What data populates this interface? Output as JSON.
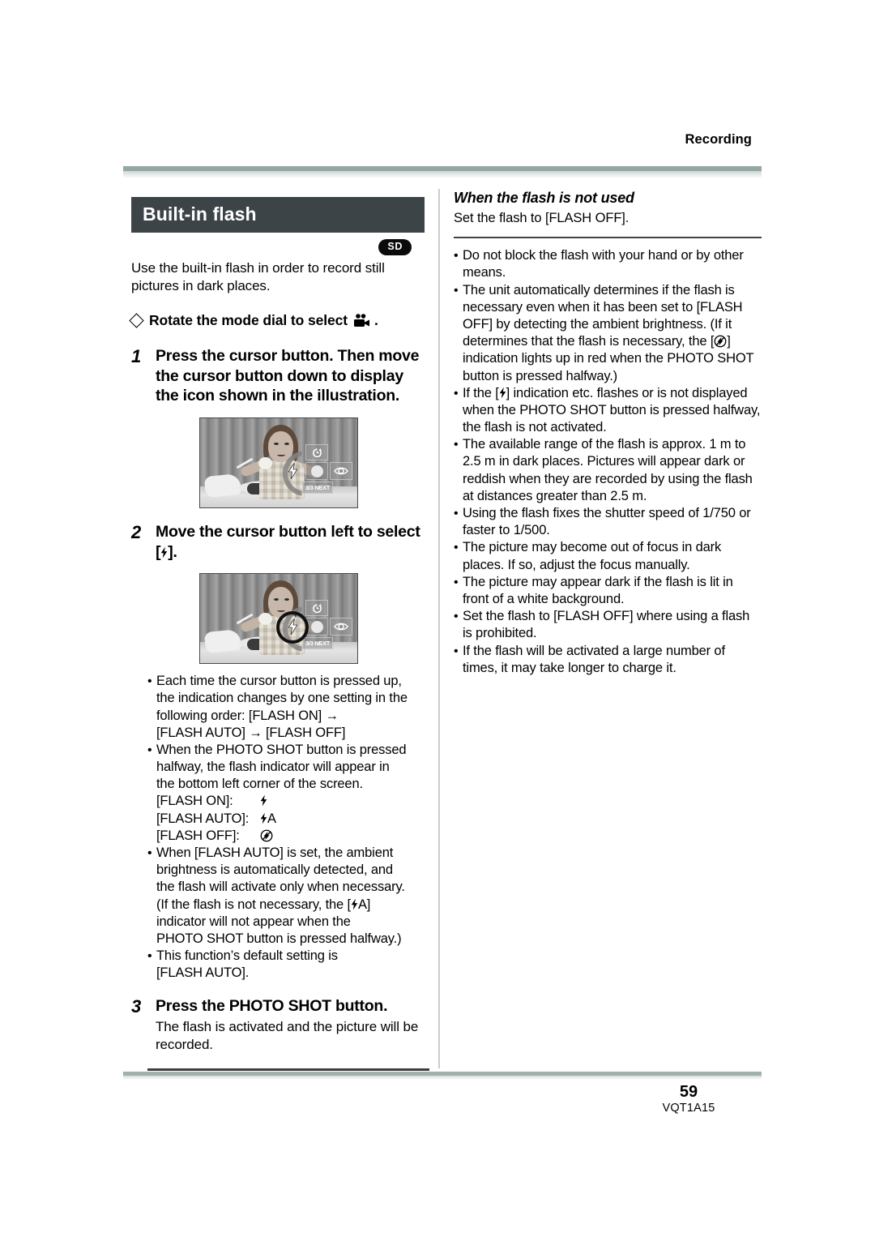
{
  "running_head": "Recording",
  "footer": {
    "page_number": "59",
    "doc_code": "VQT1A15"
  },
  "left_column": {
    "section_title": "Built-in flash",
    "sd_badge": "SD",
    "intro": "Use the built-in flash in order to record still pictures in dark places.",
    "prep_before": "Rotate the mode dial to select",
    "prep_after": ".",
    "steps": [
      {
        "number": "1",
        "text": "Press the cursor button. Then move the cursor button down to display the icon shown in the illustration."
      },
      {
        "number": "2",
        "text_before": "Move the cursor button left to select [",
        "text_after": "]."
      },
      {
        "number": "3",
        "text": "Press the PHOTO SHOT button.",
        "sub": "The flash is activated and the picture will be recorded."
      }
    ],
    "photo_osd": {
      "bottom_label": "3/3 NEXT",
      "top_icon": "self-timer-icon",
      "left_icon": "flash-icon",
      "right_icon": "red-eye-reduction-icon",
      "center_icon": "record-button-icon"
    },
    "bullets": [
      {
        "lines": [
          "Each time the cursor button is pressed up,",
          "the indication changes by one setting in the",
          "following order: [FLASH ON] →",
          "[FLASH AUTO] → [FLASH OFF]"
        ]
      },
      {
        "lines": [
          "When the PHOTO SHOT button is pressed",
          "halfway, the flash indicator will appear in",
          "the bottom left corner of the screen."
        ],
        "indicator_rows": [
          {
            "label": "[FLASH ON]:",
            "icon": "flash-on-icon"
          },
          {
            "label": "[FLASH AUTO]:",
            "icon": "flash-auto-icon"
          },
          {
            "label": "[FLASH OFF]:",
            "icon": "flash-off-icon"
          }
        ]
      },
      {
        "lines_a": [
          "When [FLASH AUTO] is set, the ambient",
          "brightness is automatically detected, and",
          "the flash will activate only when necessary.",
          "(If the flash is not necessary, the ["
        ],
        "lines_b": [
          "indicator will not appear when the",
          "PHOTO SHOT button is pressed halfway.)"
        ],
        "inline_icon": "flash-auto-icon",
        "after_icon": "A]"
      },
      {
        "lines": [
          "This function’s default setting is",
          "[FLASH AUTO]."
        ]
      }
    ]
  },
  "right_column": {
    "heading": "When the flash is not used",
    "sub": "Set the flash to [FLASH OFF].",
    "bullets": [
      {
        "type": "plain",
        "text": "Do not block the flash with your hand or by other means."
      },
      {
        "type": "icon-split",
        "before": "The unit automatically determines if the flash is necessary even when it has been set to [FLASH OFF] by detecting the ambient brightness. (If it determines that the flash is necessary, the [",
        "icon": "flash-off-icon",
        "after": "] indication lights up in red when the PHOTO SHOT button is pressed halfway.)"
      },
      {
        "type": "icon-split",
        "before": "If the [",
        "icon": "flash-on-icon",
        "after": "] indication etc. flashes or is not displayed when the PHOTO SHOT button is pressed halfway, the flash is not activated."
      },
      {
        "type": "plain",
        "text": "The available range of the flash is approx. 1 m to 2.5 m in dark places. Pictures will appear dark or reddish when they are recorded by using the flash at distances greater than 2.5 m."
      },
      {
        "type": "plain",
        "text": "Using the flash fixes the shutter speed of 1/750 or faster to 1/500."
      },
      {
        "type": "plain",
        "text": "The picture may become out of focus in dark places. If so, adjust the focus manually."
      },
      {
        "type": "plain",
        "text": "The picture may appear dark if the flash is lit in front of a white background."
      },
      {
        "type": "plain",
        "text": "Set the flash to [FLASH OFF] where using a flash is prohibited."
      },
      {
        "type": "plain",
        "text": "If the flash will be activated a large number of times, it may take longer to charge it."
      }
    ]
  },
  "colors": {
    "rule_sage": "#94a7a4",
    "section_bar": "#3c4448",
    "badge_black": "#0b0b0b"
  }
}
